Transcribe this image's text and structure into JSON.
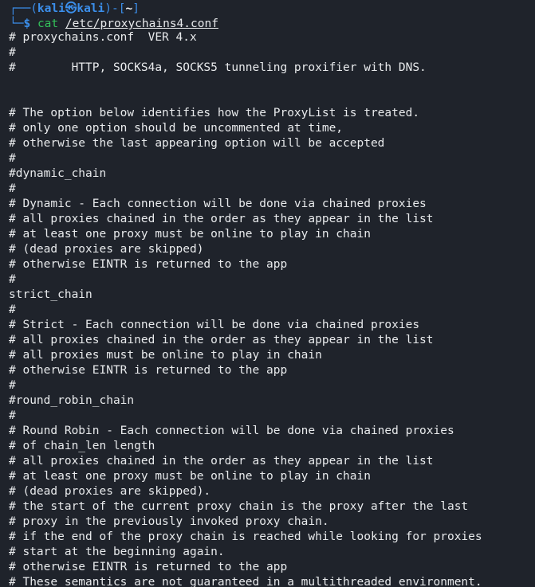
{
  "prompt": {
    "frame_open": "┌──(",
    "user": "kali",
    "at": "㉿",
    "host": "kali",
    "mid": ")-[",
    "cwd": "~",
    "frame_close": "]",
    "corner": "└─",
    "dollar": "$",
    "command": "cat",
    "argument": "/etc/proxychains4.conf"
  },
  "output": [
    "# proxychains.conf  VER 4.x",
    "#",
    "#        HTTP, SOCKS4a, SOCKS5 tunneling proxifier with DNS.",
    "",
    "",
    "# The option below identifies how the ProxyList is treated.",
    "# only one option should be uncommented at time,",
    "# otherwise the last appearing option will be accepted",
    "#",
    "#dynamic_chain",
    "#",
    "# Dynamic - Each connection will be done via chained proxies",
    "# all proxies chained in the order as they appear in the list",
    "# at least one proxy must be online to play in chain",
    "# (dead proxies are skipped)",
    "# otherwise EINTR is returned to the app",
    "#",
    "strict_chain",
    "#",
    "# Strict - Each connection will be done via chained proxies",
    "# all proxies chained in the order as they appear in the list",
    "# all proxies must be online to play in chain",
    "# otherwise EINTR is returned to the app",
    "#",
    "#round_robin_chain",
    "#",
    "# Round Robin - Each connection will be done via chained proxies",
    "# of chain_len length",
    "# all proxies chained in the order as they appear in the list",
    "# at least one proxy must be online to play in chain",
    "# (dead proxies are skipped).",
    "# the start of the current proxy chain is the proxy after the last",
    "# proxy in the previously invoked proxy chain.",
    "# if the end of the proxy chain is reached while looking for proxies",
    "# start at the beginning again.",
    "# otherwise EINTR is returned to the app",
    "# These semantics are not guaranteed in a multithreaded environment."
  ]
}
